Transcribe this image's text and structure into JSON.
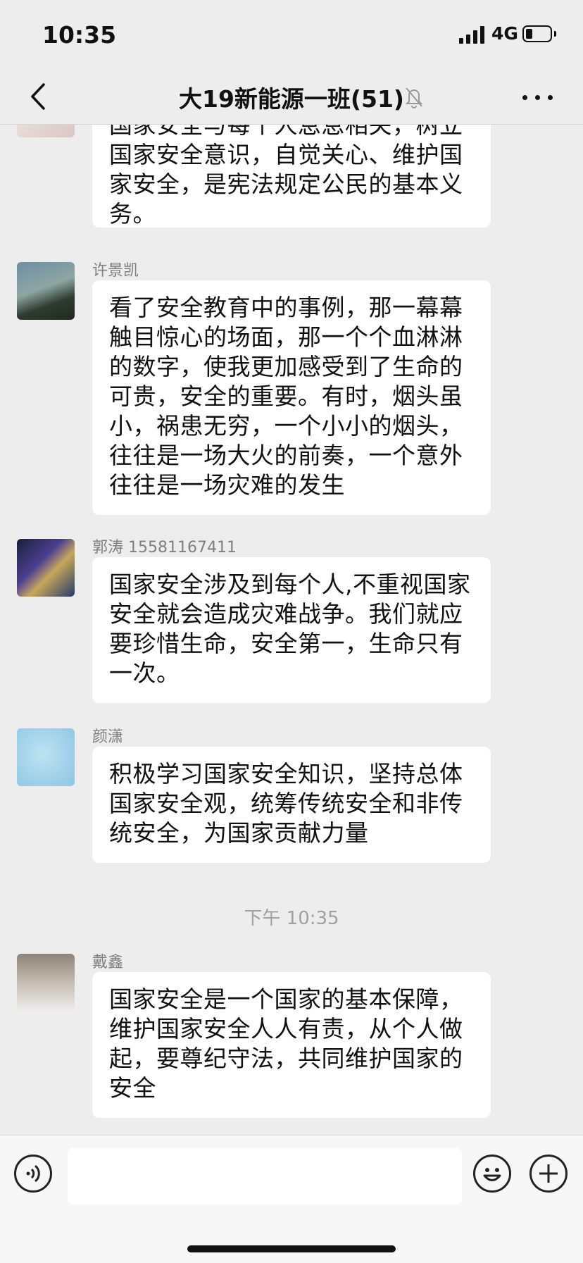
{
  "status_bar": {
    "time": "10:35",
    "network": "4G"
  },
  "nav": {
    "title": "大19新能源一班(51)"
  },
  "messages": [
    {
      "sender": "",
      "text": "国家安全与每个人息息相关，树立国家安全意识，自觉关心、维护国家安全，是宪法规定公民的基本义务。"
    },
    {
      "sender": "许景凯",
      "text": "看了安全教育中的事例，那一幕幕触目惊心的场面，那一个个血淋淋的数字，使我更加感受到了生命的可贵，安全的重要。有时，烟头虽小，祸患无穷，一个小小的烟头，往往是一场大火的前奏，一个意外往往是一场灾难的发生"
    },
    {
      "sender": "郭涛 15581167411",
      "text": "国家安全涉及到每个人,不重视国家安全就会造成灾难战争。我们就应要珍惜生命，安全第一，生命只有一次。"
    },
    {
      "sender": "颜潇",
      "text": "积极学习国家安全知识，坚持总体国家安全观，统筹传统安全和非传统安全，为国家贡献力量"
    },
    {
      "sender": "戴鑫",
      "text": "国家安全是一个国家的基本保障，维护国家安全人人有责，从个人做起，要尊纪守法，共同维护国家的安全"
    }
  ],
  "time_separator": "下午 10:35",
  "icons": {
    "back": "chevron-left-icon",
    "mute": "bell-off-icon",
    "more": "more-dots-icon",
    "voice": "voice-icon",
    "emoji": "emoji-icon",
    "add": "plus-circle-icon"
  }
}
